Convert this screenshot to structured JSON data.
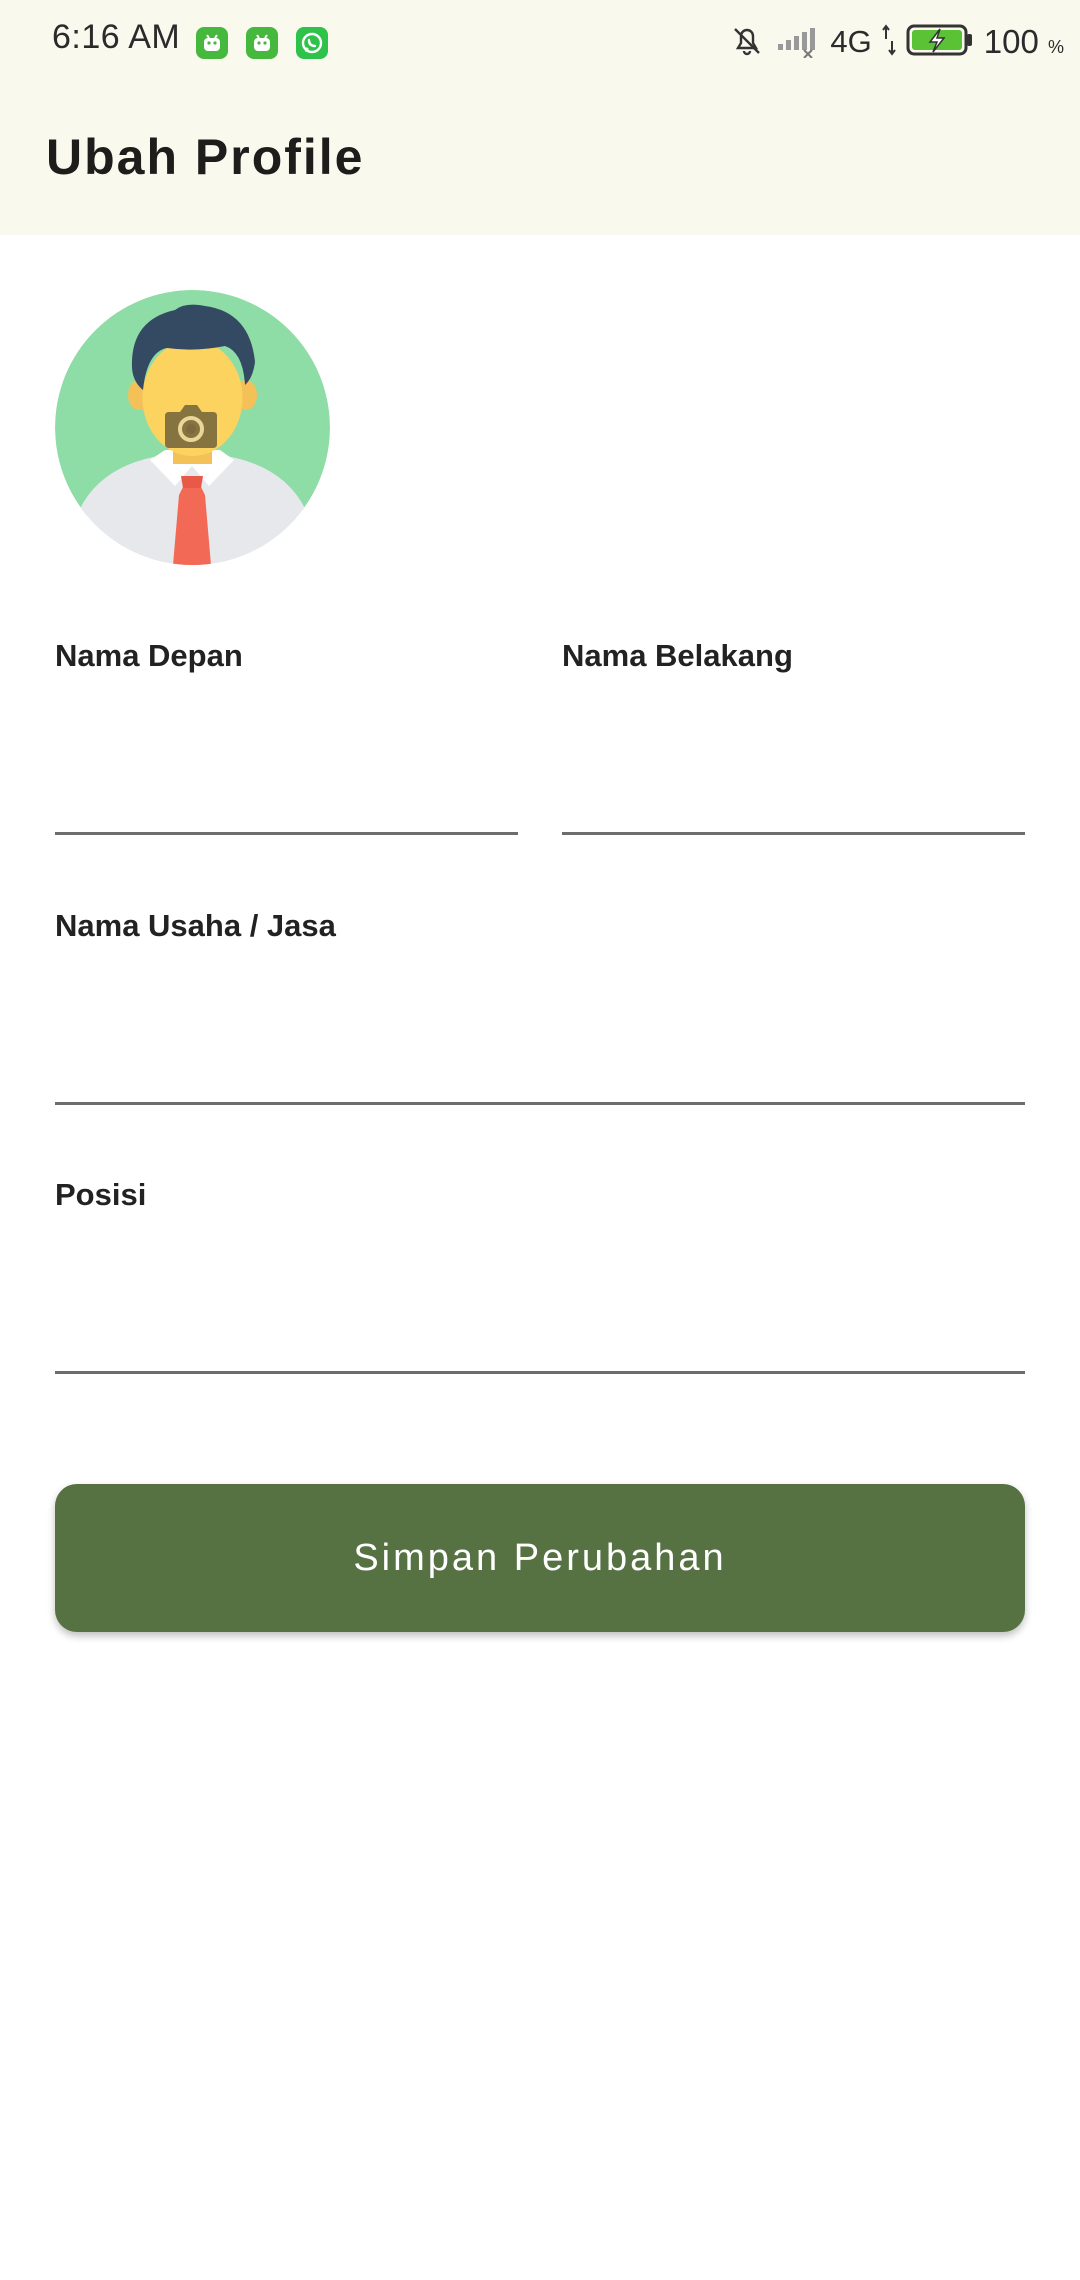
{
  "status_bar": {
    "time": "6:16 AM",
    "notification_icons": [
      "android-icon",
      "android-icon",
      "whatsapp-icon"
    ],
    "network": "4G",
    "battery_percent": "100",
    "battery_unit": "%"
  },
  "app_bar": {
    "title": "Ubah Profile"
  },
  "form": {
    "first_name": {
      "label": "Nama Depan",
      "value": "",
      "placeholder": ""
    },
    "last_name": {
      "label": "Nama Belakang",
      "value": "",
      "placeholder": ""
    },
    "business_name": {
      "label": "Nama Usaha / Jasa",
      "value": "",
      "placeholder": ""
    },
    "position": {
      "label": "Posisi",
      "value": "",
      "placeholder": ""
    }
  },
  "actions": {
    "save_label": "Simpan Perubahan"
  },
  "colors": {
    "app_bar_bg": "#f9f9ee",
    "primary_button": "#567142",
    "avatar_bg": "#8fdda6",
    "notification_icon": "#46b83d"
  }
}
